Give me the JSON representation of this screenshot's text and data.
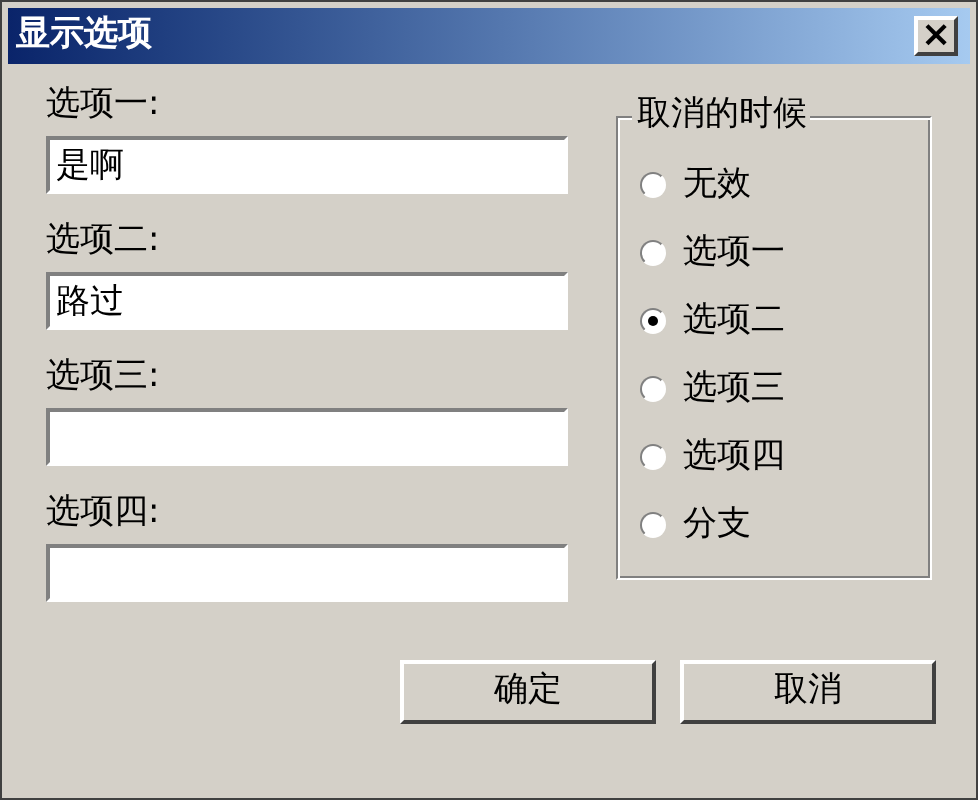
{
  "window": {
    "title": "显示选项",
    "close": "×"
  },
  "fields": [
    {
      "label": "选项一:",
      "value": "是啊"
    },
    {
      "label": "选项二:",
      "value": "路过"
    },
    {
      "label": "选项三:"
    },
    {
      "label": "选项四:"
    }
  ],
  "group": {
    "title": "取消的时候",
    "options": [
      {
        "label": "无效",
        "selected": false
      },
      {
        "label": "选项一",
        "selected": false
      },
      {
        "label": "选项二",
        "selected": true
      },
      {
        "label": "选项三",
        "selected": false
      },
      {
        "label": "选项四",
        "selected": false
      },
      {
        "label": "分支",
        "selected": false
      }
    ]
  },
  "buttons": [
    "确定",
    "取消"
  ]
}
